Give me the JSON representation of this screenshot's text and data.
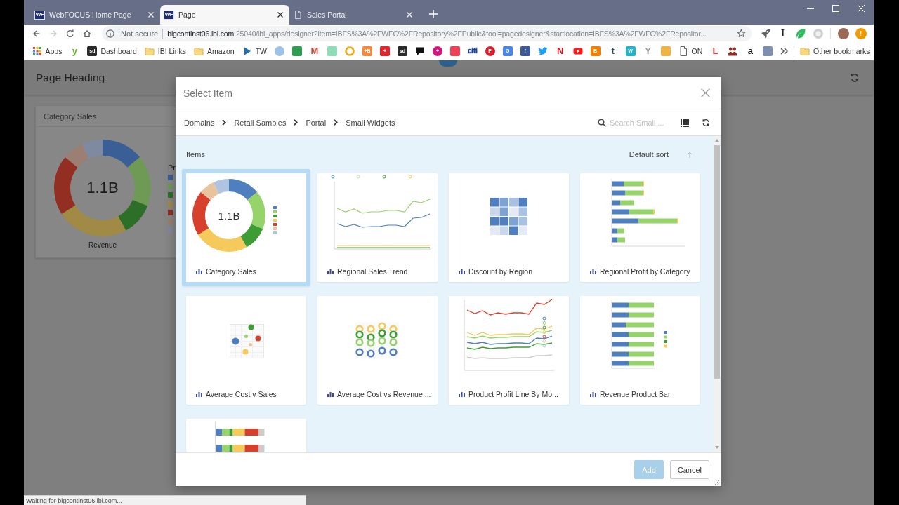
{
  "browser": {
    "tabs": [
      {
        "title": "WebFOCUS Home Page",
        "selected": false,
        "kind": "app",
        "icon_text": "WF"
      },
      {
        "title": "Page",
        "selected": true,
        "kind": "app",
        "icon_text": "WF"
      },
      {
        "title": "Sales Portal",
        "selected": false,
        "kind": "page"
      }
    ],
    "nav_buttons": [
      {
        "kind": "back",
        "disabled": false
      },
      {
        "kind": "forward",
        "disabled": true
      },
      {
        "kind": "reload",
        "disabled": false
      },
      {
        "kind": "home",
        "disabled": false
      }
    ],
    "address_bar": {
      "security": "Not secure",
      "host": "bigcontinst06.ibi.com",
      "path": ":25040/ibi_apps/designer?item=IBFS%3A%2FWFC%2FRepository%2FPublic&tool=pagedesigner&startlocation=IBFS%3A%2FWFC%2FRepositor..."
    },
    "extensions": [
      {
        "kind": "rocket"
      },
      {
        "kind": "letter",
        "glyph": "I"
      },
      {
        "kind": "leaf"
      },
      {
        "kind": "disc"
      },
      {
        "kind": "avatar"
      },
      {
        "kind": "alert",
        "glyph": "!"
      }
    ],
    "bookmarks": [
      {
        "kind": "grid",
        "label": "Apps"
      },
      {
        "kind": "letter",
        "glyph": "y",
        "color": "#6ab023"
      },
      {
        "kind": "tile",
        "glyph": "sd",
        "color": "#2b2b2b",
        "label": "Dashboard"
      },
      {
        "kind": "folder",
        "label": "IBI Links"
      },
      {
        "kind": "folder",
        "label": "Amazon"
      },
      {
        "kind": "play",
        "color": "#1f6fb5",
        "label": "TW"
      },
      {
        "kind": "round",
        "color": "#9cc3e6"
      },
      {
        "kind": "tile",
        "color": "#2f9e52"
      },
      {
        "kind": "letter",
        "glyph": "M",
        "color": "#d44638"
      },
      {
        "kind": "tile",
        "color": "#8fdcb8"
      },
      {
        "kind": "ring",
        "color": "#f2a60c"
      },
      {
        "kind": "tile",
        "glyph": "+B",
        "color": "#f5883a"
      },
      {
        "kind": "tile",
        "glyph": "+",
        "color": "#e0262b"
      },
      {
        "kind": "tile",
        "glyph": "sd",
        "color": "#2b2b2b"
      },
      {
        "kind": "bubble",
        "color": "#111111"
      },
      {
        "kind": "round",
        "glyph": "+",
        "color": "#d4177f"
      },
      {
        "kind": "tile",
        "color": "#ee4056"
      },
      {
        "kind": "letter",
        "glyph": "citi",
        "color": "#1b3f8b"
      },
      {
        "kind": "round",
        "glyph": "P",
        "color": "#d6202a"
      },
      {
        "kind": "tile",
        "glyph": "G",
        "color": "#4a86e8"
      },
      {
        "kind": "tile",
        "glyph": "f",
        "color": "#3b5998"
      },
      {
        "kind": "bird",
        "color": "#1da1f2"
      },
      {
        "kind": "letter",
        "glyph": "N",
        "color": "#e50914"
      },
      {
        "kind": "video",
        "color": "#ff1a1a"
      },
      {
        "kind": "tile",
        "glyph": "B",
        "color": "#f57d00"
      },
      {
        "kind": "letter",
        "glyph": "t",
        "color": "#35465c"
      },
      {
        "kind": "tile",
        "glyph": "W",
        "color": "#22b5c9"
      },
      {
        "kind": "letter",
        "glyph": "Y",
        "color": "#9a9a9a"
      },
      {
        "kind": "tile",
        "color": "#f0b445"
      },
      {
        "kind": "page",
        "label": "ON"
      },
      {
        "kind": "letter",
        "glyph": "L",
        "color": "#e53935"
      },
      {
        "kind": "people",
        "color": "#8b2f2a"
      },
      {
        "kind": "letter",
        "glyph": "a",
        "color": "#111111"
      },
      {
        "kind": "tile",
        "color": "#7d8fb0"
      }
    ],
    "other_bookmarks": "Other bookmarks"
  },
  "page": {
    "heading": "Page Heading",
    "card": {
      "title": "Category Sales",
      "center_label": "1.1B",
      "caption": "Revenue",
      "legend_title": "Pr",
      "legend": [
        {
          "color": "#3a5f96"
        },
        {
          "color": "#6f9a55"
        },
        {
          "color": "#2d6f28"
        },
        {
          "color": "#a08a45"
        },
        {
          "color": "#922e22"
        },
        {
          "color": "#9a7f72"
        },
        {
          "color": "#7f8aa0"
        }
      ]
    }
  },
  "dialog": {
    "title": "Select Item",
    "breadcrumb": [
      "Domains",
      "Retail Samples",
      "Portal",
      "Small Widgets"
    ],
    "search": {
      "placeholder": "Search Small ..."
    },
    "section_label": "Items",
    "sort": {
      "label": "Default sort"
    },
    "items": [
      {
        "title": "Category Sales",
        "selected": true,
        "kind": "donut",
        "center_label": "1.1B"
      },
      {
        "title": "Regional Sales Trend",
        "selected": false,
        "kind": "line"
      },
      {
        "title": "Discount by Region",
        "selected": false,
        "kind": "heatmap"
      },
      {
        "title": "Regional Profit by Category",
        "selected": false,
        "kind": "bar"
      },
      {
        "title": "Average Cost v Sales",
        "selected": false,
        "kind": "scatter"
      },
      {
        "title": "Average Cost vs Revenue ...",
        "selected": false,
        "kind": "rings"
      },
      {
        "title": "Product Profit Line By Mo...",
        "selected": false,
        "kind": "multiline"
      },
      {
        "title": "Revenue Product Bar",
        "selected": false,
        "kind": "bar100"
      },
      {
        "selected": false,
        "kind": "stacked"
      }
    ],
    "buttons": [
      {
        "label": "Add",
        "kind": "primary",
        "disabled": true
      },
      {
        "label": "Cancel",
        "kind": "secondary",
        "disabled": false
      }
    ]
  },
  "status_bar": "Waiting for bigcontinst06.ibi.com..."
}
